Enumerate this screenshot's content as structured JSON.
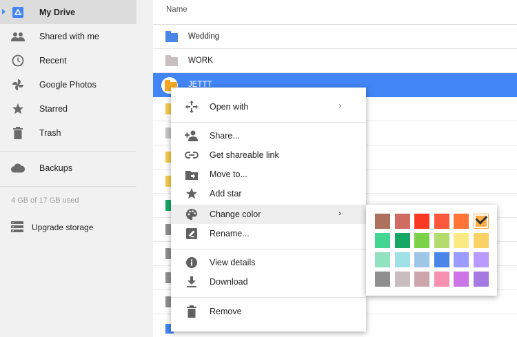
{
  "sidebar": {
    "items": [
      {
        "label": "My Drive",
        "icon": "drive-icon"
      },
      {
        "label": "Shared with me",
        "icon": "people-icon"
      },
      {
        "label": "Recent",
        "icon": "clock-icon"
      },
      {
        "label": "Google Photos",
        "icon": "pinwheel-icon"
      },
      {
        "label": "Starred",
        "icon": "star-icon"
      },
      {
        "label": "Trash",
        "icon": "trash-icon"
      },
      {
        "label": "Backups",
        "icon": "cloud-icon"
      }
    ],
    "storage": "4 GB of 17 GB used",
    "upgrade": "Upgrade storage"
  },
  "list": {
    "header": "Name",
    "rows": [
      {
        "name": "Wedding",
        "color": "#4a86e8"
      },
      {
        "name": "WORK",
        "color": "#c9bfbf"
      },
      {
        "name": "JETTT",
        "color": "#f6a623"
      }
    ],
    "partial_folder_colors": [
      "#f4c94c",
      "#c5c5c5",
      "#f4c94c",
      "#f4c94c",
      "#16a765",
      "#8f8f8f",
      "#8f8f8f",
      "#8f8f8f",
      "#8f8f8f"
    ]
  },
  "menu": {
    "items": [
      {
        "label": "Open with",
        "icon": "move-arrows-icon",
        "submenu": true
      },
      {
        "label": "Share...",
        "icon": "add-person-icon"
      },
      {
        "label": "Get shareable link",
        "icon": "link-icon"
      },
      {
        "label": "Move to...",
        "icon": "move-folder-icon"
      },
      {
        "label": "Add star",
        "icon": "star-icon"
      },
      {
        "label": "Change color",
        "icon": "palette-icon",
        "submenu": true
      },
      {
        "label": "Rename...",
        "icon": "edit-icon"
      },
      {
        "label": "View details",
        "icon": "info-icon"
      },
      {
        "label": "Download",
        "icon": "download-icon"
      },
      {
        "label": "Remove",
        "icon": "trash-icon"
      }
    ]
  },
  "palette": {
    "colors": [
      [
        "#ac725e",
        "#d06b64",
        "#f83a22",
        "#fa573c",
        "#ff7537",
        "#ffad46"
      ],
      [
        "#42d692",
        "#16a765",
        "#7bd148",
        "#b3dc6c",
        "#fbe983",
        "#fad165"
      ],
      [
        "#92e1c0",
        "#9fe1e7",
        "#9fc6e7",
        "#4986e7",
        "#9a9cff",
        "#b99aff"
      ],
      [
        "#8f8f8f",
        "#cabdbf",
        "#cca6ac",
        "#f691b2",
        "#cd74e6",
        "#a47ae2"
      ]
    ],
    "selected": [
      0,
      5
    ]
  }
}
